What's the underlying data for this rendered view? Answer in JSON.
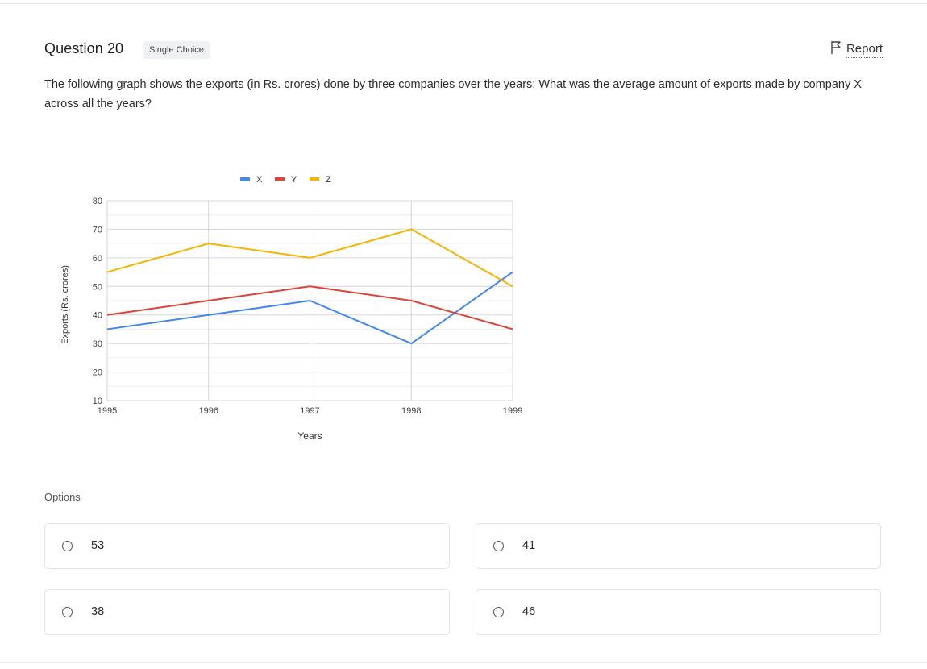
{
  "question": {
    "title": "Question 20",
    "type_badge": "Single Choice",
    "report_label": "Report",
    "text": "The following graph shows the exports (in Rs. crores) done by three companies over the years: What was the average amount of exports made by company X across all the years?"
  },
  "options_label": "Options",
  "options": [
    {
      "label": "53"
    },
    {
      "label": "41"
    },
    {
      "label": "38"
    },
    {
      "label": "46"
    }
  ],
  "icons": {
    "report": "flag-icon",
    "option": "radio-icon"
  },
  "colors": {
    "X": "#4285f4",
    "Y": "#db4437",
    "Z": "#f4b400",
    "grid": "#d6d6d6"
  },
  "chart_data": {
    "type": "line",
    "xlabel": "Years",
    "ylabel": "Exports (Rs. crores)",
    "x": [
      "1995",
      "1996",
      "1997",
      "1998",
      "1999"
    ],
    "ylim": [
      10,
      80
    ],
    "yticks": [
      10,
      20,
      30,
      40,
      50,
      60,
      70,
      80
    ],
    "grid": true,
    "legend_position": "top",
    "series": [
      {
        "name": "X",
        "color": "#4285f4",
        "values": [
          35,
          40,
          45,
          30,
          55
        ]
      },
      {
        "name": "Y",
        "color": "#db4437",
        "values": [
          40,
          45,
          50,
          45,
          35
        ]
      },
      {
        "name": "Z",
        "color": "#f4b400",
        "values": [
          55,
          65,
          60,
          70,
          50
        ]
      }
    ]
  }
}
